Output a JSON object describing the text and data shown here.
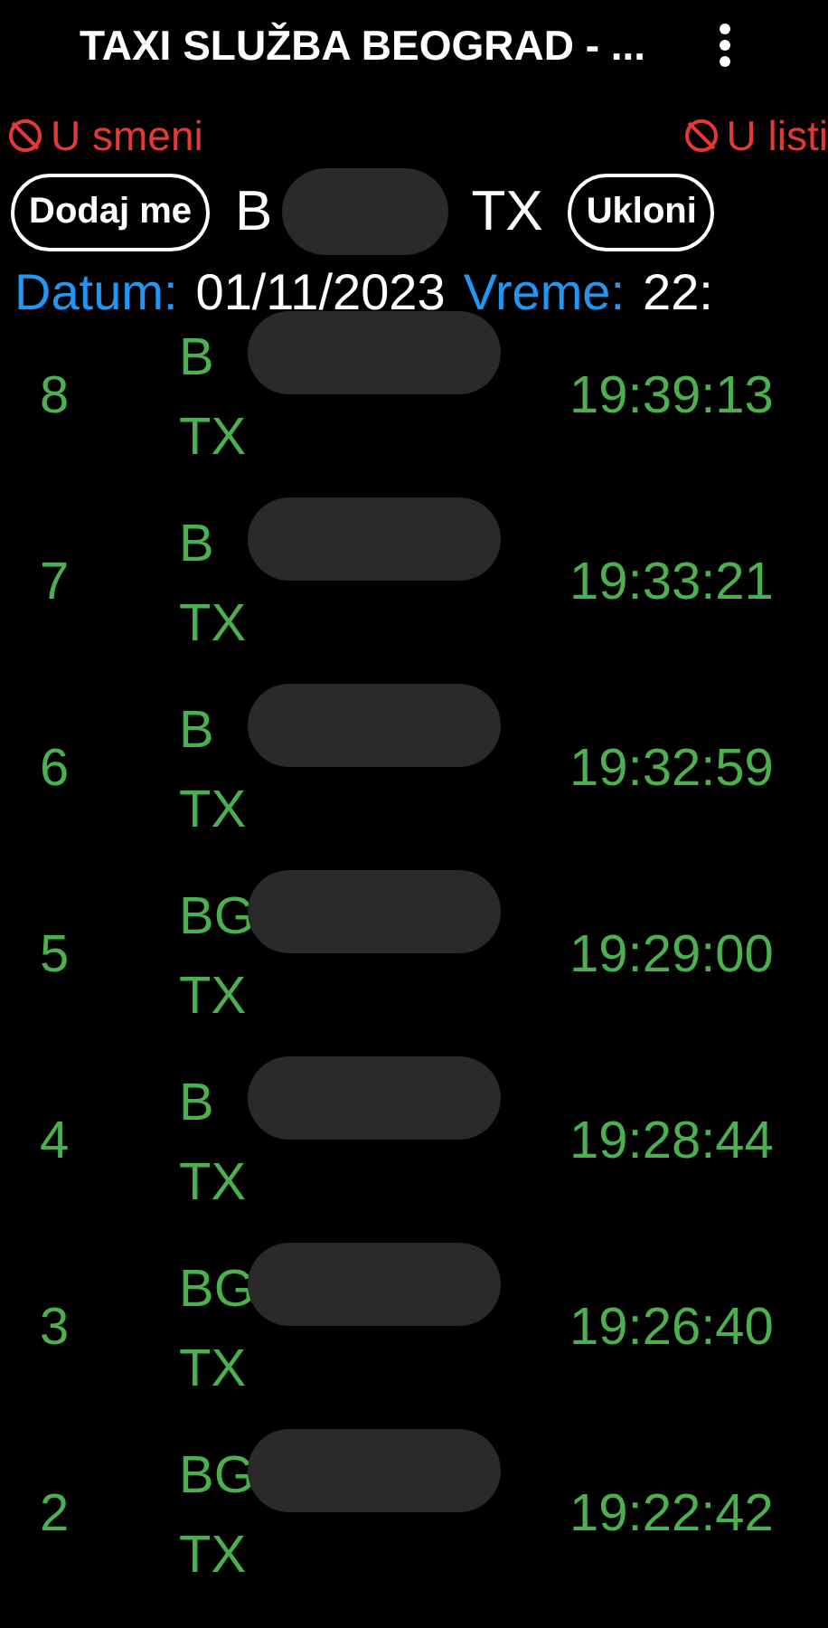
{
  "app_bar": {
    "title": "TAXI SLUŽBA BEOGRAD - ..."
  },
  "status": [
    {
      "label": "U smeni",
      "active": false
    },
    {
      "label": "U listi",
      "active": false
    }
  ],
  "vehicle": {
    "add_button": "Dodaj me",
    "plate_start": "B",
    "plate_end": "TX",
    "remove_button": "Ukloni"
  },
  "date_row": {
    "date_label": "Datum:",
    "date": "01/11/2023",
    "time_label": "Vreme:",
    "time": "22:"
  },
  "entries": [
    {
      "number": "8",
      "plate_start": "B",
      "plate_end": "TX",
      "time": "19:39:13"
    },
    {
      "number": "7",
      "plate_start": "B",
      "plate_end": "TX",
      "time": "19:33:21"
    },
    {
      "number": "6",
      "plate_start": "B",
      "plate_end": "TX",
      "time": "19:32:59"
    },
    {
      "number": "5",
      "plate_start": "BG",
      "plate_end": "TX",
      "time": "19:29:00"
    },
    {
      "number": "4",
      "plate_start": "B",
      "plate_end": "TX",
      "time": "19:28:44"
    },
    {
      "number": "3",
      "plate_start": "BG",
      "plate_end": "TX",
      "time": "19:26:40"
    },
    {
      "number": "2",
      "plate_start": "BG",
      "plate_end": "TX",
      "time": "19:22:42"
    }
  ]
}
